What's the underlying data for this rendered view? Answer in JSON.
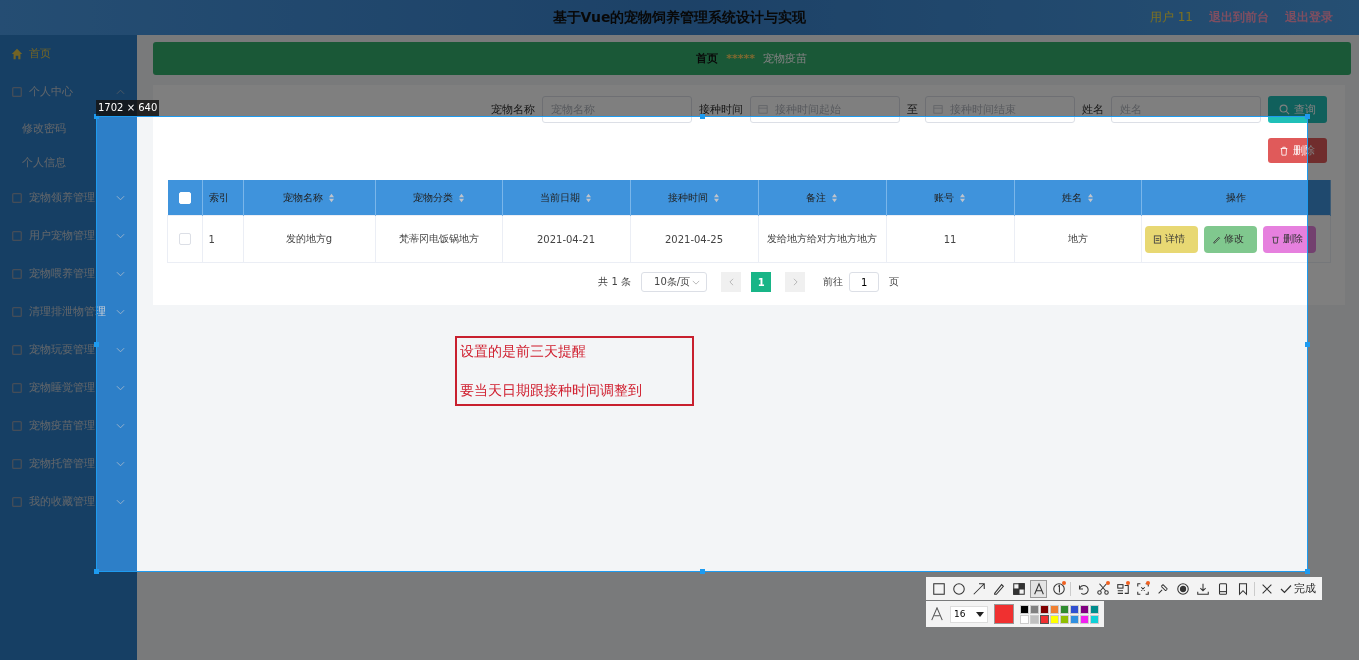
{
  "header": {
    "title": "基于Vue的宠物饲养管理系统设计与实现",
    "user": "用户 11",
    "links": [
      "退出到前台",
      "退出登录"
    ]
  },
  "sidebar": {
    "items": [
      {
        "kind": "home",
        "label": "首页",
        "selected": true
      },
      {
        "kind": "group",
        "label": "个人中心",
        "selected": false,
        "expanded": true,
        "children": [
          {
            "label": "修改密码",
            "selected": false
          },
          {
            "label": "个人信息",
            "selected": false
          }
        ]
      },
      {
        "kind": "group",
        "label": "宠物领养管理",
        "selected": false,
        "expanded": false
      },
      {
        "kind": "group",
        "label": "用户宠物管理",
        "selected": false,
        "expanded": false
      },
      {
        "kind": "group",
        "label": "宠物喂养管理",
        "selected": false,
        "expanded": false
      },
      {
        "kind": "group",
        "label": "清理排泄物管理",
        "selected": false,
        "expanded": false
      },
      {
        "kind": "group",
        "label": "宠物玩耍管理",
        "selected": false,
        "expanded": false
      },
      {
        "kind": "group",
        "label": "宠物睡觉管理",
        "selected": false,
        "expanded": false
      },
      {
        "kind": "group",
        "label": "宠物疫苗管理",
        "selected": false,
        "expanded": false
      },
      {
        "kind": "group",
        "label": "宠物托管管理",
        "selected": false,
        "expanded": false
      },
      {
        "kind": "group",
        "label": "我的收藏管理",
        "selected": false,
        "expanded": false
      }
    ]
  },
  "breadcrumb": {
    "home": "首页",
    "separator": "*****",
    "current": "宠物疫苗"
  },
  "search": {
    "fields": [
      {
        "kind": "text",
        "label": "宠物名称",
        "placeholder": "宠物名称"
      },
      {
        "kind": "date",
        "label": "接种时间",
        "placeholder": "接种时间起始"
      },
      {
        "kind": "date",
        "label": "至",
        "placeholder": "接种时间结束"
      },
      {
        "kind": "text",
        "label": "姓名",
        "placeholder": "姓名"
      }
    ],
    "button": "查询"
  },
  "delete_button": "删除",
  "table": {
    "all_checked": false,
    "columns": [
      {
        "label": "索引",
        "sortable": false
      },
      {
        "label": "宠物名称",
        "sortable": true
      },
      {
        "label": "宠物分类",
        "sortable": true
      },
      {
        "label": "当前日期",
        "sortable": true
      },
      {
        "label": "接种时间",
        "sortable": true
      },
      {
        "label": "备注",
        "sortable": true
      },
      {
        "label": "账号",
        "sortable": true
      },
      {
        "label": "姓名",
        "sortable": true
      },
      {
        "label": "操作",
        "sortable": false
      }
    ],
    "rows": [
      {
        "checked": false,
        "cells": [
          "1",
          "发的地方g",
          "梵蒂冈电饭锅地方",
          "2021-04-21",
          "2021-04-25",
          "发给地方给对方地方地方",
          "11",
          "地方"
        ],
        "actions": [
          {
            "kind": "detail",
            "label": "详情"
          },
          {
            "kind": "edit",
            "label": "修改"
          },
          {
            "kind": "delete",
            "label": "删除"
          }
        ]
      }
    ]
  },
  "pagination": {
    "total": "共 1 条",
    "page_size": "10条/页",
    "pages": [
      {
        "label": "1",
        "selected": true
      }
    ],
    "goto_label": "前往",
    "goto_value": "1",
    "goto_suffix": "页"
  },
  "capture": {
    "size": "1702 × 640",
    "note": [
      "设置的是前三天提醒",
      "要当天日期跟接种时间调整到"
    ],
    "tools": [
      {
        "kind": "rect",
        "selected": false,
        "badge": false
      },
      {
        "kind": "ellipse",
        "selected": false,
        "badge": false
      },
      {
        "kind": "arrow",
        "selected": false,
        "badge": false
      },
      {
        "kind": "pen",
        "selected": false,
        "badge": false
      },
      {
        "kind": "mosaic",
        "selected": false,
        "badge": false
      },
      {
        "kind": "text",
        "selected": true,
        "badge": false
      },
      {
        "kind": "number",
        "selected": false,
        "badge": true
      },
      {
        "kind": "undo",
        "selected": false,
        "badge": false
      },
      {
        "kind": "cut",
        "selected": false,
        "badge": true
      },
      {
        "kind": "ocr",
        "selected": false,
        "badge": true
      },
      {
        "kind": "scan",
        "selected": false,
        "badge": true
      },
      {
        "kind": "pin",
        "selected": false,
        "badge": false
      },
      {
        "kind": "record",
        "selected": false,
        "badge": false
      },
      {
        "kind": "download",
        "selected": false,
        "badge": false
      },
      {
        "kind": "device",
        "selected": false,
        "badge": false
      },
      {
        "kind": "bookmark",
        "selected": false,
        "badge": false
      },
      {
        "kind": "close",
        "selected": false,
        "badge": false
      }
    ],
    "done": "完成",
    "font_size": "16",
    "palette": [
      {
        "color": "#000000",
        "selected": false
      },
      {
        "color": "#808080",
        "selected": false
      },
      {
        "color": "#800000",
        "selected": false
      },
      {
        "color": "#f08030",
        "selected": false
      },
      {
        "color": "#2e8b2e",
        "selected": false
      },
      {
        "color": "#3050d0",
        "selected": false
      },
      {
        "color": "#800080",
        "selected": false
      },
      {
        "color": "#008b8b",
        "selected": false
      },
      {
        "color": "#ffffff",
        "selected": false
      },
      {
        "color": "#c0c0c0",
        "selected": false
      },
      {
        "color": "#f03030",
        "selected": true
      },
      {
        "color": "#ffff00",
        "selected": false
      },
      {
        "color": "#90c000",
        "selected": false
      },
      {
        "color": "#3090e0",
        "selected": false
      },
      {
        "color": "#f020f0",
        "selected": false
      },
      {
        "color": "#10d0d8",
        "selected": false
      }
    ]
  }
}
